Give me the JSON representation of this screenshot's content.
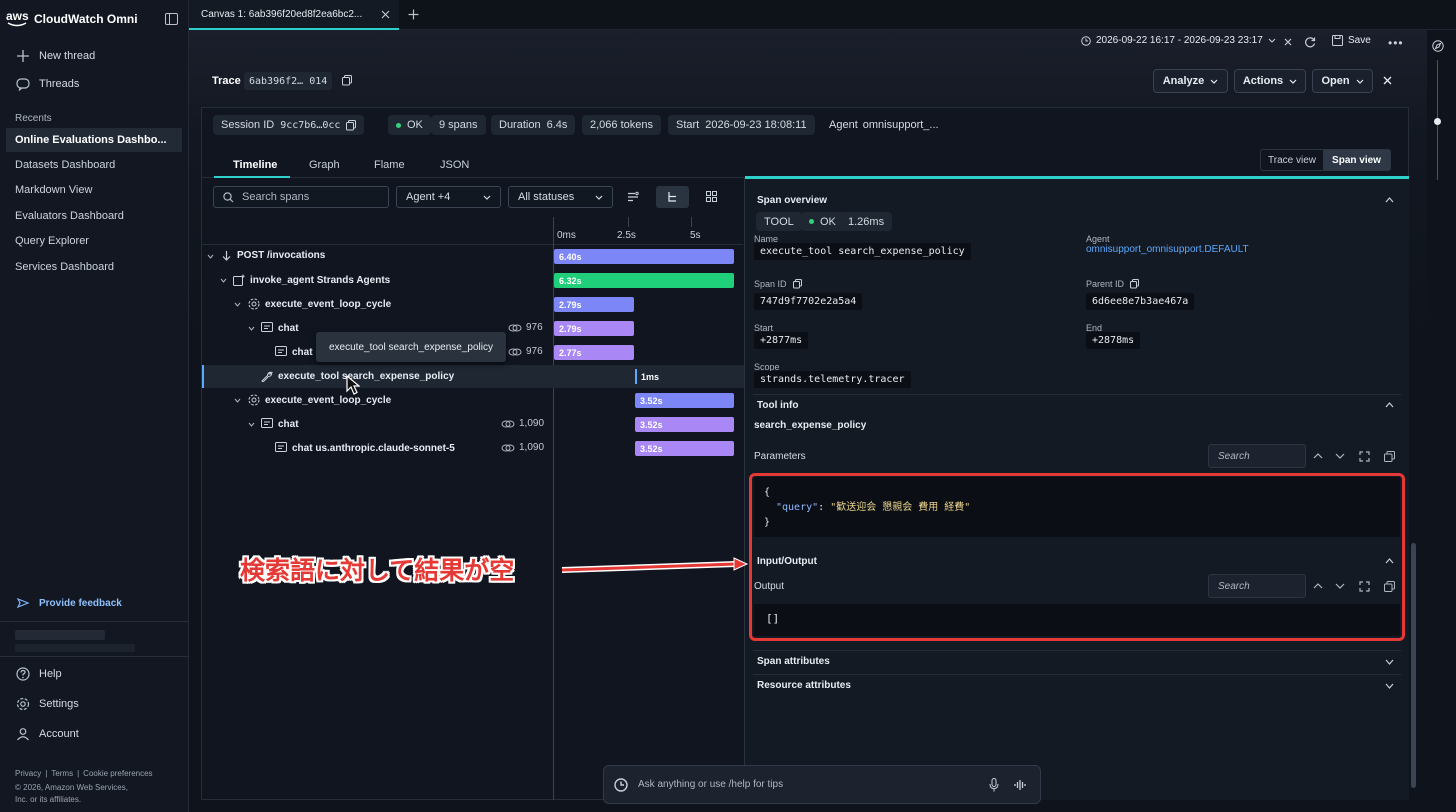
{
  "sidebar": {
    "brand": "CloudWatch Omni",
    "aws": "aws",
    "new_thread": "New thread",
    "threads": "Threads",
    "recents_header": "Recents",
    "recents": [
      "Online Evaluations Dashbo...",
      "Datasets Dashboard",
      "Markdown View",
      "Evaluators Dashboard",
      "Query Explorer",
      "Services Dashboard"
    ],
    "provide_feedback": "Provide feedback",
    "help": "Help",
    "settings": "Settings",
    "account": "Account",
    "footer_links": [
      "Privacy",
      "Terms",
      "Cookie preferences"
    ],
    "copyright_1": "© 2026, Amazon Web Services,",
    "copyright_2": "Inc. or its affiliates."
  },
  "top": {
    "tab_title": "Canvas 1: 6ab396f20ed8f2ea6bc2...",
    "date_range": "2026-09-22 16:17 - 2026-09-23 23:17",
    "save": "Save"
  },
  "trace": {
    "label": "Trace",
    "id": "6ab396f2… 014",
    "analyze": "Analyze",
    "actions": "Actions",
    "open": "Open"
  },
  "summary": {
    "session_label": "Session ID",
    "session_value": "9cc7b6…0cc",
    "status": "OK",
    "spans": "9 spans",
    "duration_label": "Duration",
    "duration_value": "6.4s",
    "tokens": "2,066 tokens",
    "start_label": "Start",
    "start_value": "2026-09-23 18:08:11",
    "agent_label": "Agent",
    "agent_value": "omnisupport_..."
  },
  "tabs": [
    "Timeline",
    "Graph",
    "Flame",
    "JSON"
  ],
  "view_toggle": {
    "trace_view": "Trace view",
    "span_view": "Span view"
  },
  "filters": {
    "search_placeholder": "Search spans",
    "agent": "Agent +4",
    "status": "All statuses"
  },
  "axis": {
    "t0": "0ms",
    "t1": "2.5s",
    "t2": "5s"
  },
  "spans": [
    {
      "name": "POST /invocations",
      "bar": "6.40s",
      "tokens": ""
    },
    {
      "name": "invoke_agent Strands Agents",
      "bar": "6.32s",
      "tokens": ""
    },
    {
      "name": "execute_event_loop_cycle",
      "bar": "2.79s",
      "tokens": ""
    },
    {
      "name": "chat",
      "bar": "2.79s",
      "tokens": "976"
    },
    {
      "name": "chat us",
      "bar": "2.77s",
      "tokens": "976"
    },
    {
      "name": "execute_tool search_expense_policy",
      "bar": "1ms",
      "tokens": ""
    },
    {
      "name": "execute_event_loop_cycle",
      "bar": "3.52s",
      "tokens": ""
    },
    {
      "name": "chat",
      "bar": "3.52s",
      "tokens": "1,090"
    },
    {
      "name": "chat us.anthropic.claude-sonnet-5",
      "bar": "3.52s",
      "tokens": "1,090"
    }
  ],
  "tooltip": "execute_tool search_expense_policy",
  "detail": {
    "overview_title": "Span overview",
    "kind": "TOOL",
    "status": "OK",
    "duration": "1.26ms",
    "name_label": "Name",
    "name_value": "execute_tool search_expense_policy",
    "agent_label": "Agent",
    "agent_value": "omnisupport_omnisupport.DEFAULT",
    "span_id_label": "Span ID",
    "span_id_value": "747d9f7702e2a5a4",
    "parent_id_label": "Parent ID",
    "parent_id_value": "6d6ee8e7b3ae467a",
    "start_label": "Start",
    "start_value": "+2877ms",
    "end_label": "End",
    "end_value": "+2878ms",
    "scope_label": "Scope",
    "scope_value": "strands.telemetry.tracer",
    "tool_info_title": "Tool info",
    "tool_name": "search_expense_policy",
    "parameters_label": "Parameters",
    "search_placeholder": "Search",
    "json_open": "{",
    "json_key": "\"query\"",
    "json_colon": ": ",
    "json_value": "\"歓送迎会 懇親会 費用 経費\"",
    "json_close": "}",
    "io_title": "Input/Output",
    "output_label": "Output",
    "output_value": "[]",
    "span_attributes": "Span attributes",
    "resource_attributes": "Resource attributes"
  },
  "annotation": {
    "text": "検索語に対して結果が空",
    "color": "#e53935"
  },
  "chat_input": {
    "placeholder": "Ask anything or use  /help for tips"
  },
  "colors": {
    "accent": "#2fd0c9",
    "ok": "#35d07f",
    "bar_blue": "#7c86f7",
    "bar_purple": "#a987f5",
    "bar_green": "#1fcf7a",
    "link": "#5aa8ff"
  }
}
